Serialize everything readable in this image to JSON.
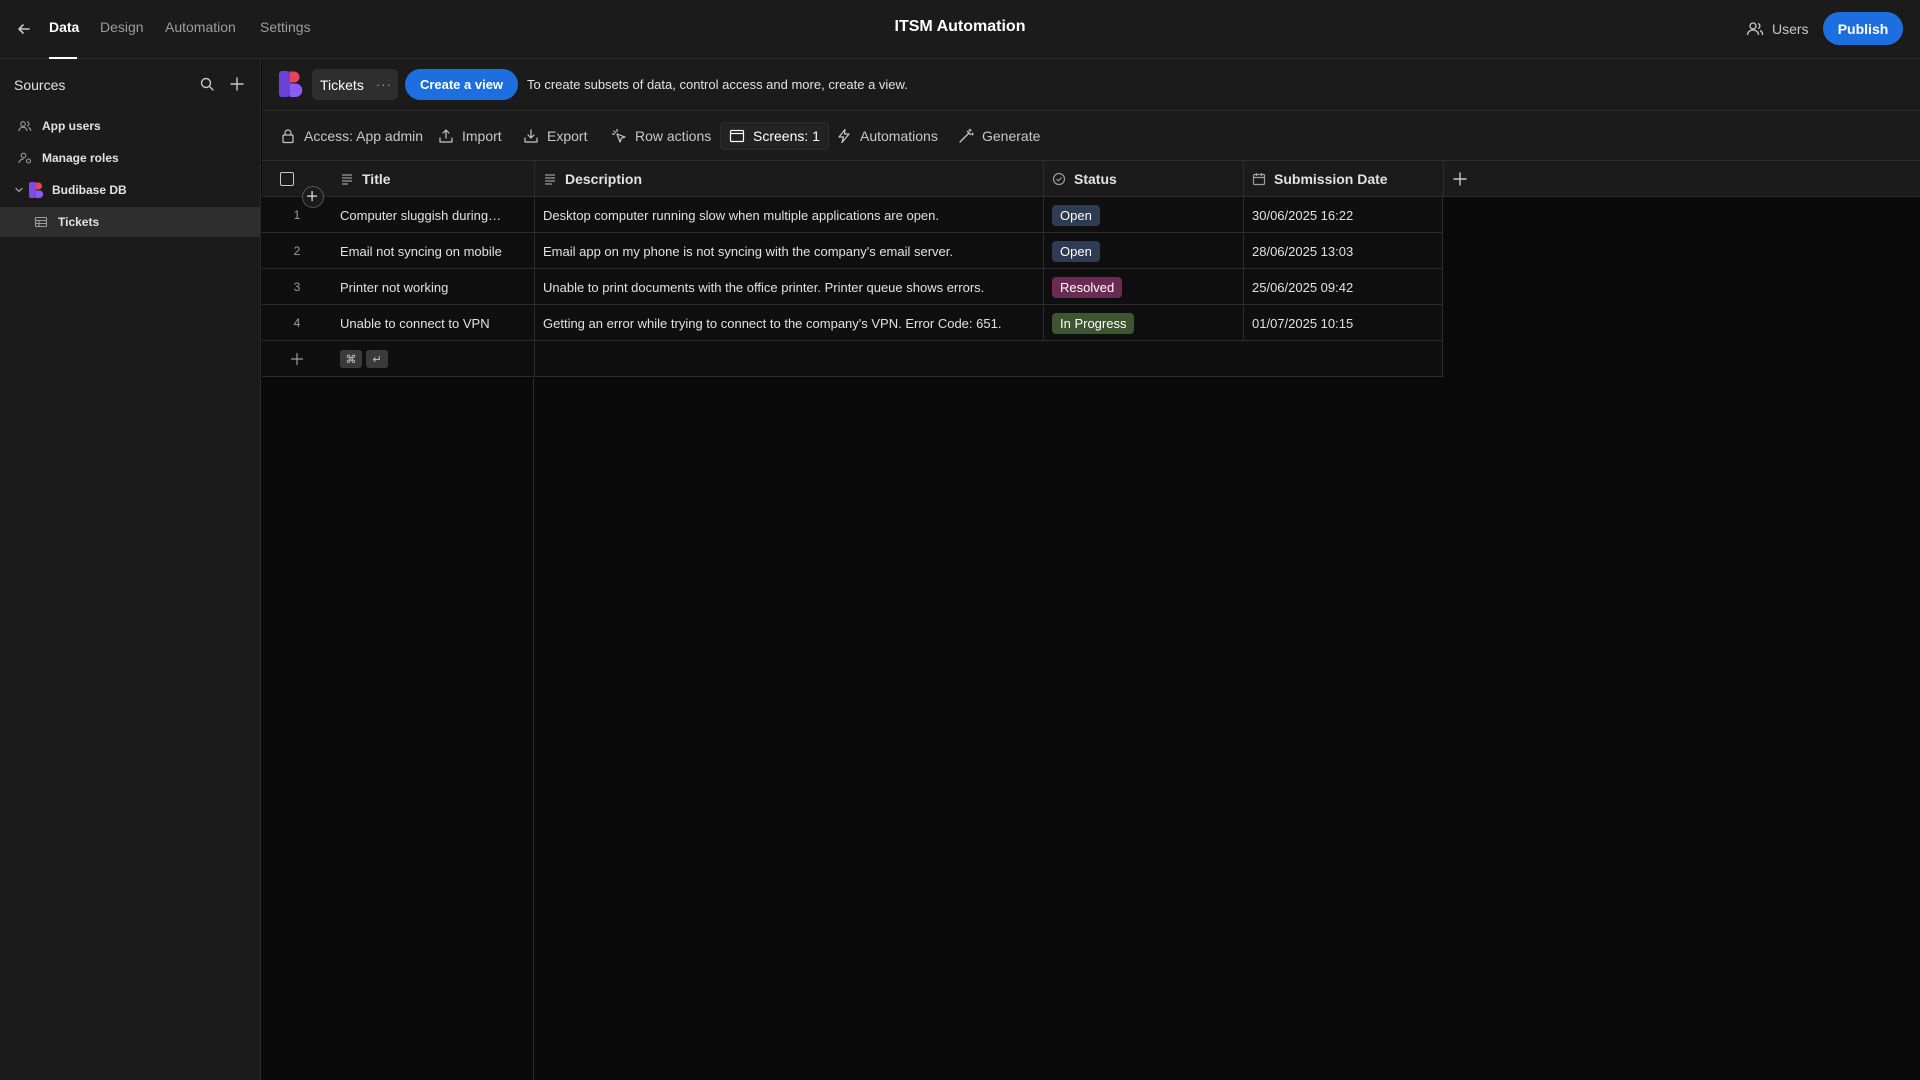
{
  "topbar": {
    "tabs": [
      {
        "label": "Data",
        "active": true
      },
      {
        "label": "Design",
        "active": false
      },
      {
        "label": "Automation",
        "active": false
      },
      {
        "label": "Settings",
        "active": false
      }
    ],
    "app_title": "ITSM Automation",
    "users_label": "Users",
    "publish_label": "Publish"
  },
  "sidebar": {
    "title": "Sources",
    "items": [
      {
        "label": "App users",
        "icon": "users-icon"
      },
      {
        "label": "Manage roles",
        "icon": "user-roles-icon"
      },
      {
        "label": "Budibase DB",
        "icon": "budibase-logo"
      },
      {
        "label": "Tickets",
        "icon": "table-icon",
        "selected": true
      }
    ]
  },
  "tablebar": {
    "table_name": "Tickets",
    "more": "···",
    "create_view_label": "Create a view",
    "hint": "To create subsets of data, control access and more, create a view."
  },
  "toolbar": {
    "access": "Access: App admin",
    "import": "Import",
    "export": "Export",
    "row_actions": "Row actions",
    "screens": "Screens: 1",
    "automations": "Automations",
    "generate": "Generate"
  },
  "grid": {
    "columns": [
      "Title",
      "Description",
      "Status",
      "Submission Date"
    ],
    "rows": [
      {
        "num": "1",
        "title": "Computer sluggish during…",
        "description": "Desktop computer running slow when multiple applications are open.",
        "status": "Open",
        "date": "30/06/2025 16:22"
      },
      {
        "num": "2",
        "title": "Email not syncing on mobile",
        "description": "Email app on my phone is not syncing with the company's email server.",
        "status": "Open",
        "date": "28/06/2025 13:03"
      },
      {
        "num": "3",
        "title": "Printer not working",
        "description": "Unable to print documents with the office printer. Printer queue shows errors.",
        "status": "Resolved",
        "date": "25/06/2025 09:42"
      },
      {
        "num": "4",
        "title": "Unable to connect to VPN",
        "description": "Getting an error while trying to connect to the company's VPN. Error Code: 651.",
        "status": "In Progress",
        "date": "01/07/2025 10:15"
      }
    ],
    "keys": [
      "⌘",
      "↵"
    ]
  },
  "colors": {
    "accent": "#1d6fe0",
    "status_open": "#2f3b53",
    "status_resolved": "#6b2b52",
    "status_in_progress": "#3d5531"
  }
}
